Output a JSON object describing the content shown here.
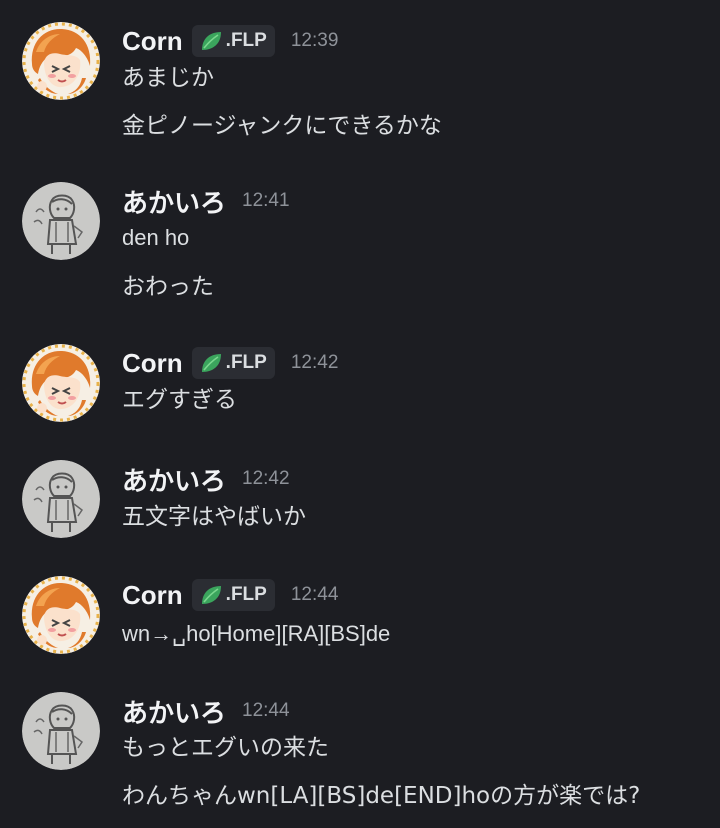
{
  "messages": [
    {
      "author": "Corn",
      "tag": ".FLP",
      "tag_icon": "leaf-icon",
      "time": "12:39",
      "lines": [
        "あまじか",
        "金ピノージャンクにできるかな"
      ]
    },
    {
      "author": "あかいろ",
      "time": "12:41",
      "lines": [
        "den ho",
        "おわった"
      ]
    },
    {
      "author": "Corn",
      "tag": ".FLP",
      "tag_icon": "leaf-icon",
      "time": "12:42",
      "lines": [
        "エグすぎる"
      ]
    },
    {
      "author": "あかいろ",
      "time": "12:42",
      "lines": [
        "五文字はやばいか"
      ]
    },
    {
      "author": "Corn",
      "tag": ".FLP",
      "tag_icon": "leaf-icon",
      "time": "12:44",
      "lines": [
        "wn→␣ho[Home][RA][BS]de"
      ]
    },
    {
      "author": "あかいろ",
      "time": "12:44",
      "lines": [
        "もっとエグいの来た",
        "わんちゃんwn[LA][BS]de[END]hoの方が楽では?"
      ]
    }
  ],
  "colors": {
    "background": "#1c1d22",
    "username": "#f2f3f5",
    "message_text": "#dbdee1",
    "timestamp": "#8e9299",
    "tag_background": "#2b2d33",
    "leaf": "#3ba55d"
  }
}
